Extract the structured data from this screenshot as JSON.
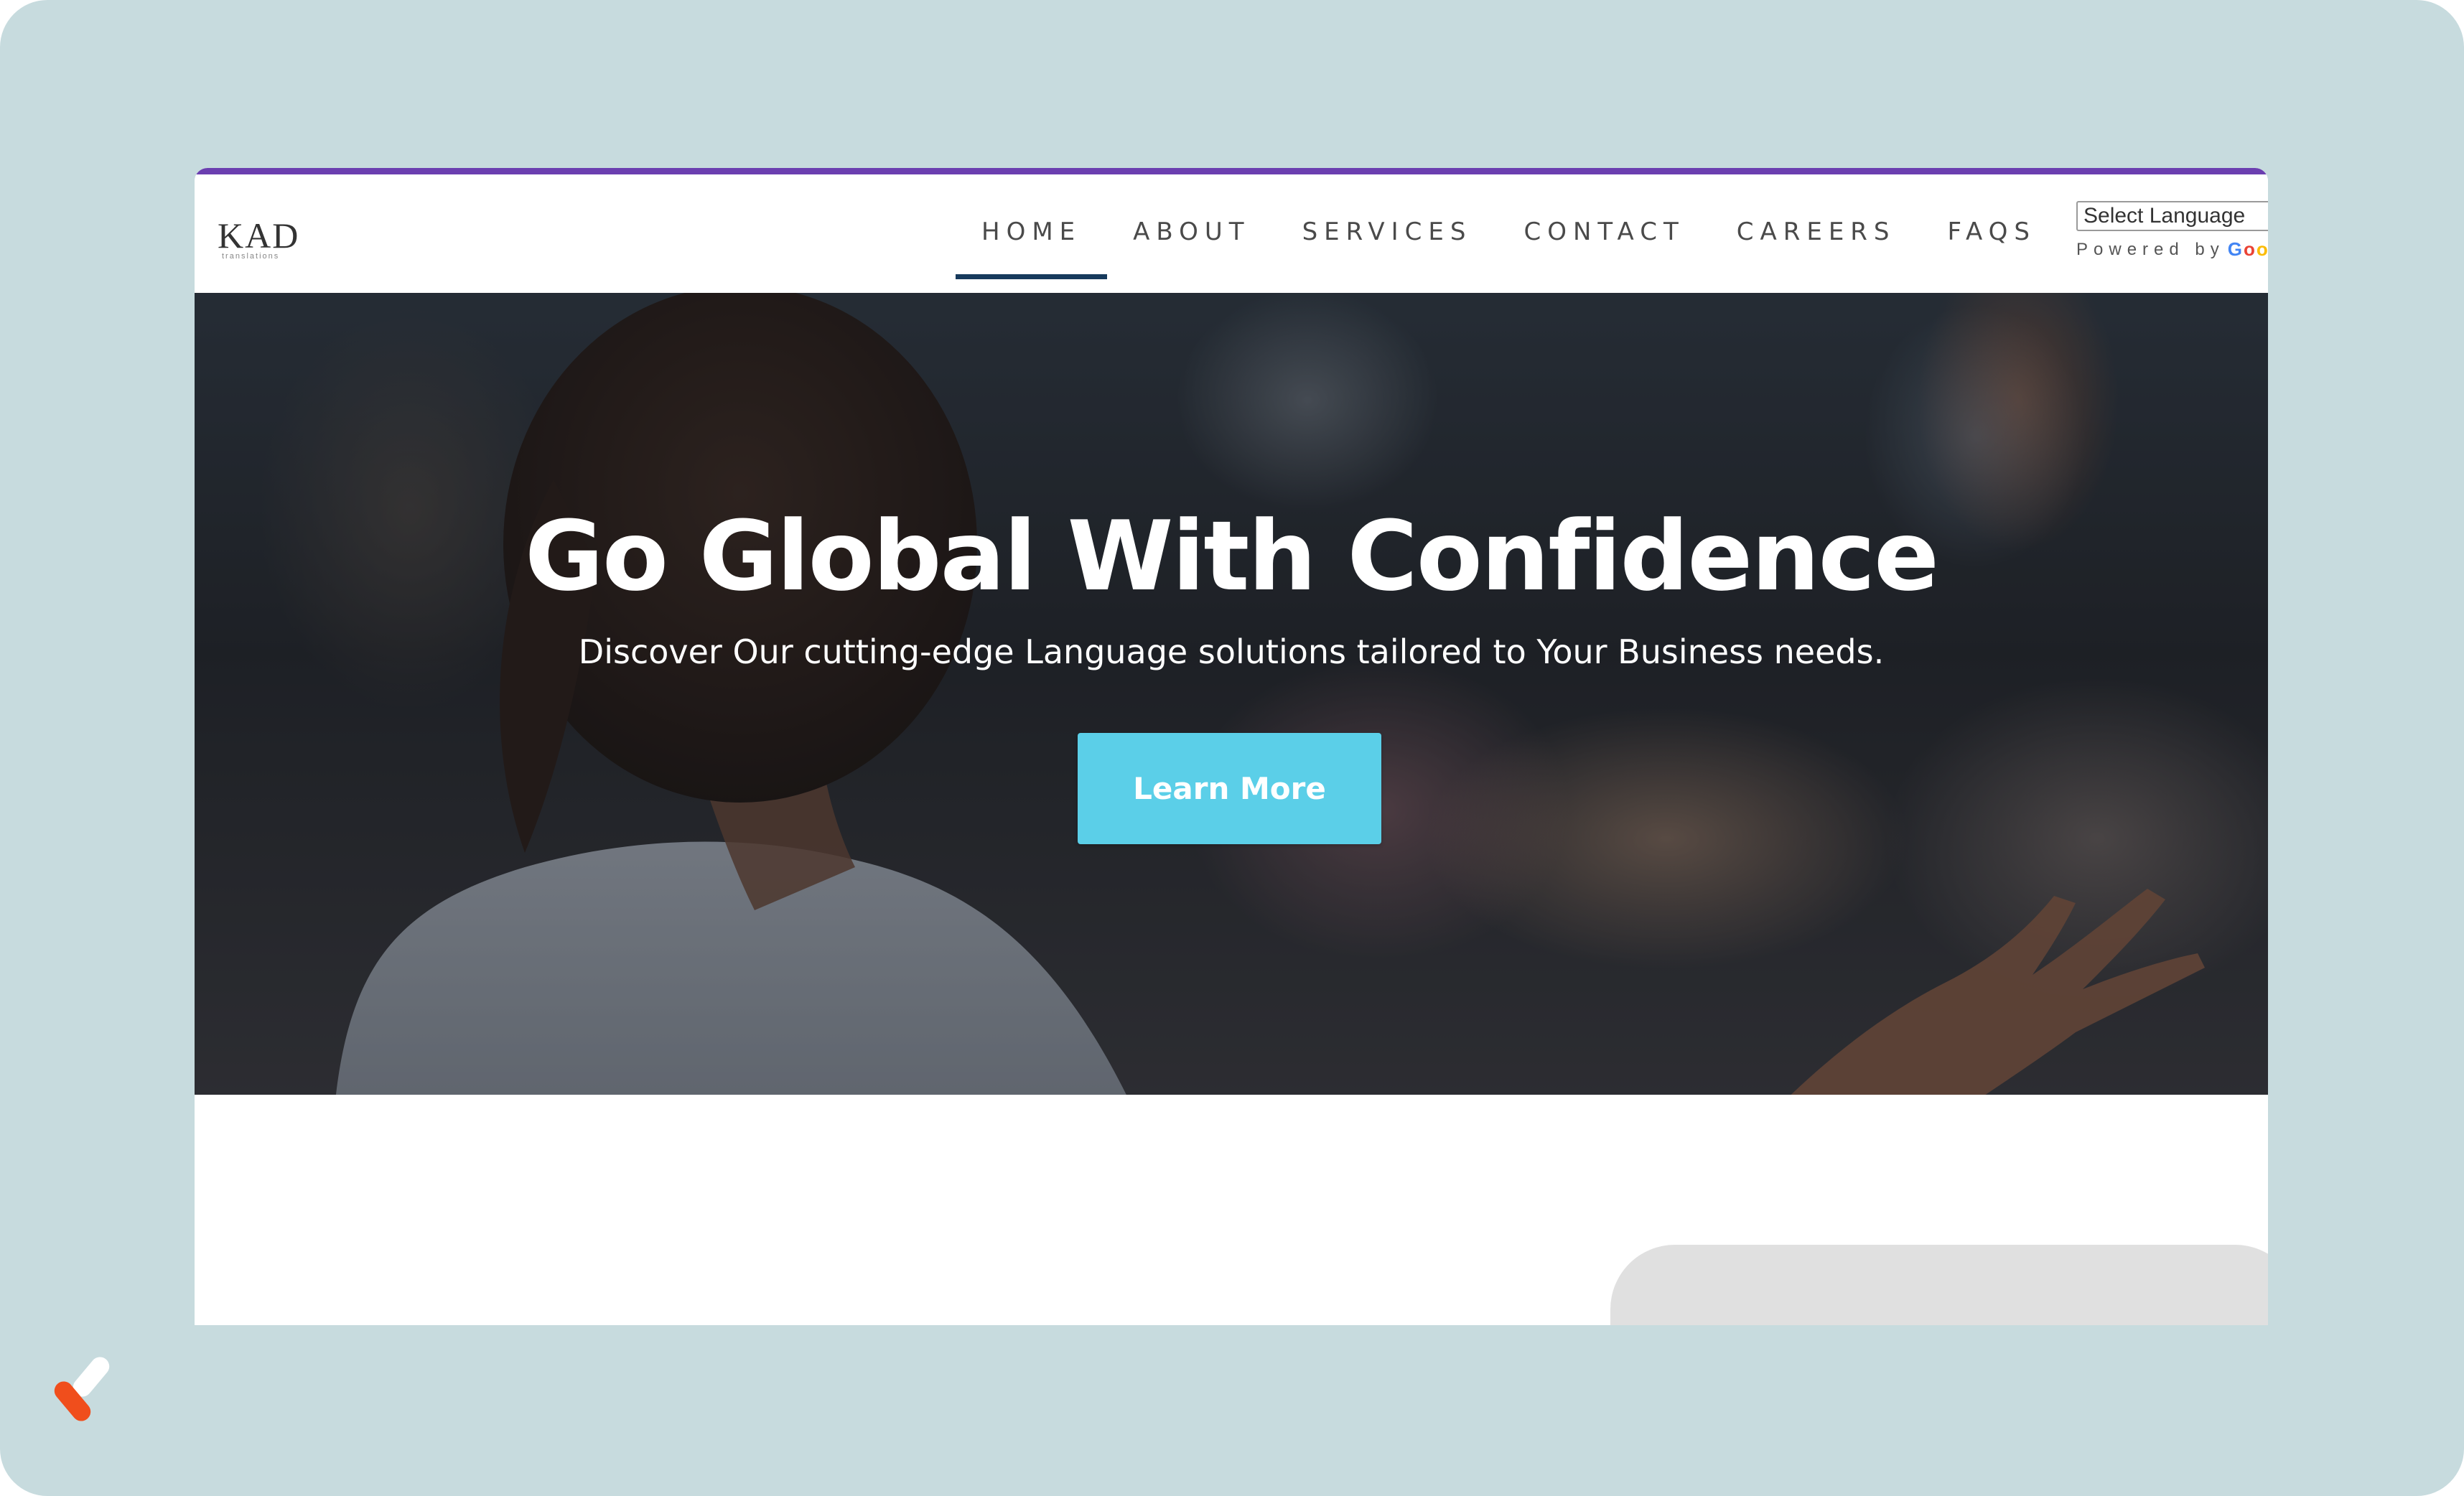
{
  "logo": {
    "name": "KAD",
    "sub": "translations"
  },
  "nav": {
    "items": [
      {
        "label": "HOME",
        "active": true
      },
      {
        "label": "ABOUT",
        "active": false
      },
      {
        "label": "SERVICES",
        "active": false
      },
      {
        "label": "CONTACT",
        "active": false
      },
      {
        "label": "CAREERS",
        "active": false
      },
      {
        "label": "FAQS",
        "active": false
      }
    ]
  },
  "translate": {
    "select_label": "Select Language",
    "powered_by": "Powered by",
    "google": "Google"
  },
  "hero": {
    "title": "Go Global With Confidence",
    "subtitle": "Discover Our cutting-edge Language solutions tailored to Your Business needs.",
    "cta_label": "Learn More"
  },
  "colors": {
    "accent_top_line": "#6b3fb0",
    "nav_underline": "#173a5c",
    "cta_button": "#5bcfe8",
    "frame_background": "#c7dbde"
  }
}
